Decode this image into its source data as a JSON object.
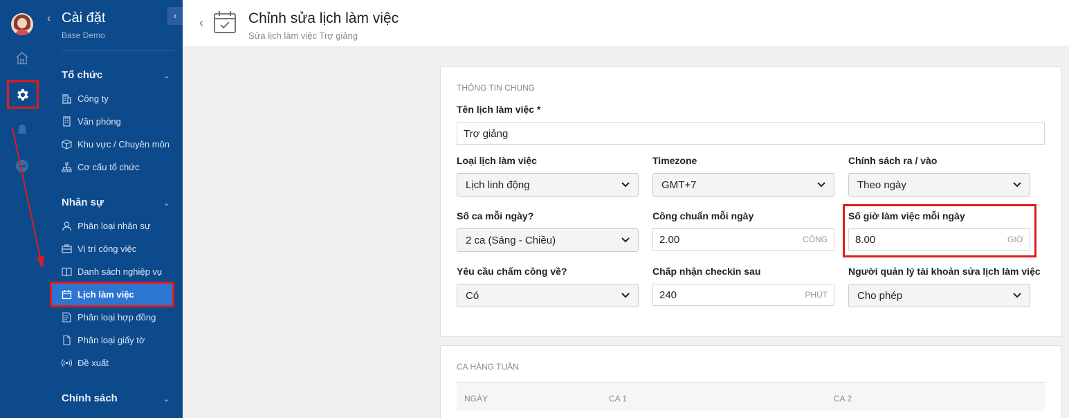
{
  "sidebar": {
    "title": "Cài đặt",
    "subtitle": "Base Demo",
    "groups": [
      {
        "label": "Tổ chức",
        "items": [
          "Công ty",
          "Văn phòng",
          "Khu vực / Chuyên môn",
          "Cơ cấu tổ chức"
        ]
      },
      {
        "label": "Nhân sự",
        "items": [
          "Phân loại nhân sự",
          "Vị trí công việc",
          "Danh sách nghiệp vụ",
          "Lịch làm việc",
          "Phân loại hợp đồng",
          "Phân loại giấy tờ",
          "Đề xuất"
        ]
      },
      {
        "label": "Chính sách"
      }
    ],
    "active_item": "Lịch làm việc"
  },
  "header": {
    "title": "Chỉnh sửa lịch làm việc",
    "subtitle": "Sửa lịch làm việc Trợ giảng"
  },
  "general": {
    "section_title": "THÔNG TIN CHUNG",
    "name_label": "Tên lịch làm việc *",
    "name_value": "Trợ giảng",
    "type_label": "Loại lịch làm việc",
    "type_value": "Lịch linh động",
    "timezone_label": "Timezone",
    "timezone_value": "GMT+7",
    "policy_label": "Chính sách ra / vào",
    "policy_value": "Theo ngày",
    "shifts_label": "Số ca mỗi ngày?",
    "shifts_value": "2 ca (Sáng - Chiều)",
    "workday_label": "Công chuẩn mỗi ngày",
    "workday_value": "2.00",
    "workday_unit": "CÔNG",
    "hours_label": "Số giờ làm việc mỗi ngày",
    "hours_value": "8.00",
    "hours_unit": "GIỜ",
    "require_label": "Yêu cầu chấm công về?",
    "require_value": "Có",
    "checkin_label": "Chấp nhận checkin sau",
    "checkin_value": "240",
    "checkin_unit": "PHÚT",
    "manager_label": "Người quản lý tài khoản sửa lịch làm việc",
    "manager_value": "Cho phép"
  },
  "weekly": {
    "section_title": "CA HÀNG TUẦN",
    "columns": [
      "NGÀY",
      "CA 1",
      "CA 2"
    ]
  },
  "colors": {
    "sidebar_bg": "#0d4a8c",
    "active_bg": "#2c76d2",
    "highlight": "#e01b1b"
  },
  "icons": [
    "home-icon",
    "gear-icon",
    "bell-icon",
    "minus-circle-icon",
    "building-icon",
    "office-icon",
    "cube-icon",
    "org-chart-icon",
    "user-icon",
    "briefcase-icon",
    "book-icon",
    "calendar-icon",
    "contract-icon",
    "document-icon",
    "broadcast-icon"
  ]
}
